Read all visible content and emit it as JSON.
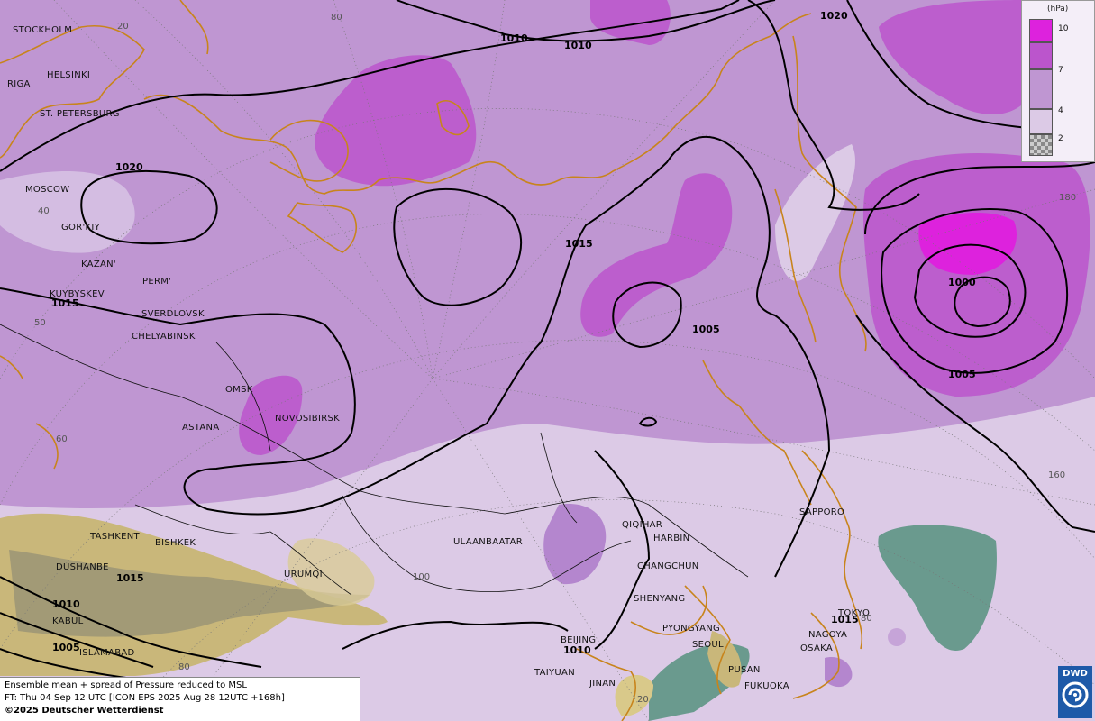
{
  "legend": {
    "unit": "(hPa)",
    "levels": [
      {
        "label": "10",
        "color": "#dd22dd"
      },
      {
        "label": "7",
        "color": "#bb55cc"
      },
      {
        "label": "4",
        "color": "#bf96d2"
      },
      {
        "label": "2",
        "color": "#dccae6"
      }
    ]
  },
  "info": {
    "line1": "Ensemble mean + spread of Pressure reduced to MSL",
    "line2": "FT: Thu 04 Sep 12 UTC [ICON EPS 2025 Aug 28 12UTC +168h]",
    "line3": "©2025 Deutscher Wetterdienst"
  },
  "logo": {
    "text": "DWD",
    "icon": "dwd-spiral-icon"
  },
  "cities": [
    "STOCKHOLM",
    "HELSINKI",
    "RIGA",
    "ST. PETERSBURG",
    "MOSCOW",
    "GOR'KIY",
    "KAZAN'",
    "PERM'",
    "KUYBYSKEV",
    "SVERDLOVSK",
    "CHELYABINSK",
    "OMSK",
    "NOVOSIBIRSK",
    "ASTANA",
    "TASHKENT",
    "BISHKEK",
    "DUSHANBE",
    "URUMQI",
    "ULAANBAATAR",
    "KABUL",
    "ISLAMABAD",
    "QIQIHAR",
    "HARBIN",
    "CHANGCHUN",
    "SHENYANG",
    "PYONGYANG",
    "SEOUL",
    "PUSAN",
    "FUKUOKA",
    "BEIJING",
    "TAIYUAN",
    "JINAN",
    "SAPPORO",
    "TOKYO",
    "NAGOYA",
    "OSAKA"
  ],
  "isobar_labels": [
    "1010",
    "1010",
    "1020",
    "1020",
    "1015",
    "1015",
    "1005",
    "1000",
    "1005",
    "1015",
    "1010",
    "1005",
    "1010",
    "1015"
  ],
  "grid_labels": [
    "20",
    "80",
    "40",
    "50",
    "60",
    "100",
    "180",
    "160",
    "80",
    "20",
    "80"
  ],
  "colors": {
    "ocean_spread_low": "#6a9a8e",
    "terrain": "#c9b77a"
  }
}
